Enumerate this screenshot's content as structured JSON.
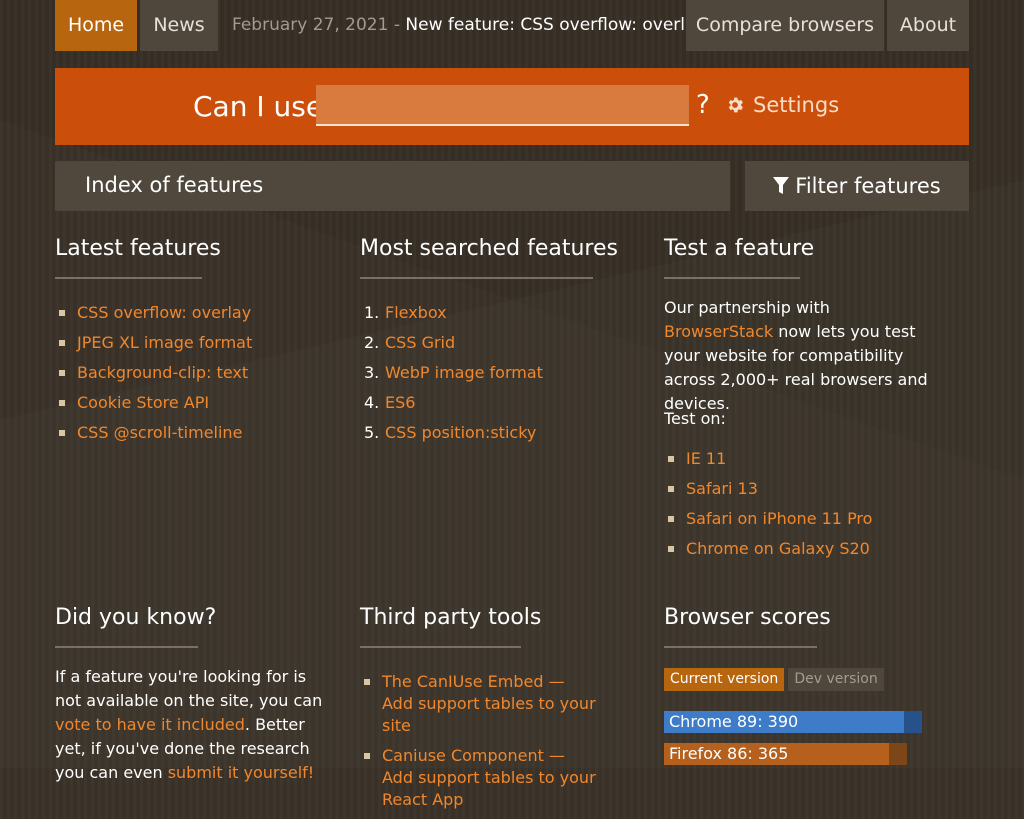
{
  "nav": {
    "home": "Home",
    "news": "News",
    "announcement_date": "February 27, 2021",
    "announcement_sep": " - ",
    "announcement_text": "New feature: CSS overflow: overlay",
    "compare": "Compare browsers",
    "about": "About"
  },
  "search": {
    "label": "Can I use",
    "value": "",
    "question": "?",
    "settings_label": "Settings",
    "settings_icon": "gear-icon"
  },
  "index": {
    "title": "Index of features",
    "filter_label": "Filter features",
    "filter_icon": "filter-icon"
  },
  "latest": {
    "title": "Latest features",
    "items": [
      "CSS overflow: overlay",
      "JPEG XL image format",
      "Background-clip: text",
      "Cookie Store API",
      "CSS @scroll-timeline"
    ]
  },
  "searched": {
    "title": "Most searched features",
    "items": [
      {
        "num": "1.",
        "label": "Flexbox"
      },
      {
        "num": "2.",
        "label": "CSS Grid"
      },
      {
        "num": "3.",
        "label": "WebP image format"
      },
      {
        "num": "4.",
        "label": "ES6"
      },
      {
        "num": "5.",
        "label": "CSS position:sticky"
      }
    ]
  },
  "test": {
    "title": "Test a feature",
    "text_before": "Our partnership with ",
    "link": "BrowserStack",
    "text_after": " now lets you test your website for compatibility across 2,000+ real browsers and devices.",
    "test_on": "Test on:",
    "items": [
      "IE 11",
      "Safari 13",
      "Safari on iPhone 11 Pro",
      "Chrome on Galaxy S20"
    ]
  },
  "didyouknow": {
    "title": "Did you know?",
    "text1": "If a feature you're looking for is not available on the site, you can ",
    "link1": "vote to have it included",
    "text2": ". Better yet, if you've done the research you can even ",
    "link2": "submit it yourself!"
  },
  "tools": {
    "title": "Third party tools",
    "items": [
      "The CanIUse Embed — Add support tables to your site",
      "Caniuse Component — Add support tables to your React App"
    ]
  },
  "scores": {
    "title": "Browser scores",
    "tab_current": "Current version",
    "tab_dev": "Dev version",
    "items": [
      {
        "label": "Chrome 89: 390",
        "value": 390,
        "dev_value": 402,
        "color": "#3e7bc8",
        "tail": "#27518a"
      },
      {
        "label": "Firefox 86: 365",
        "value": 365,
        "dev_value": 377,
        "color": "#b5601d",
        "tail": "#7d4619"
      }
    ]
  },
  "colors": {
    "accent": "#cc4e0b",
    "link": "#f0872d",
    "nav_active": "#b8650f",
    "panel": "#50483d"
  }
}
